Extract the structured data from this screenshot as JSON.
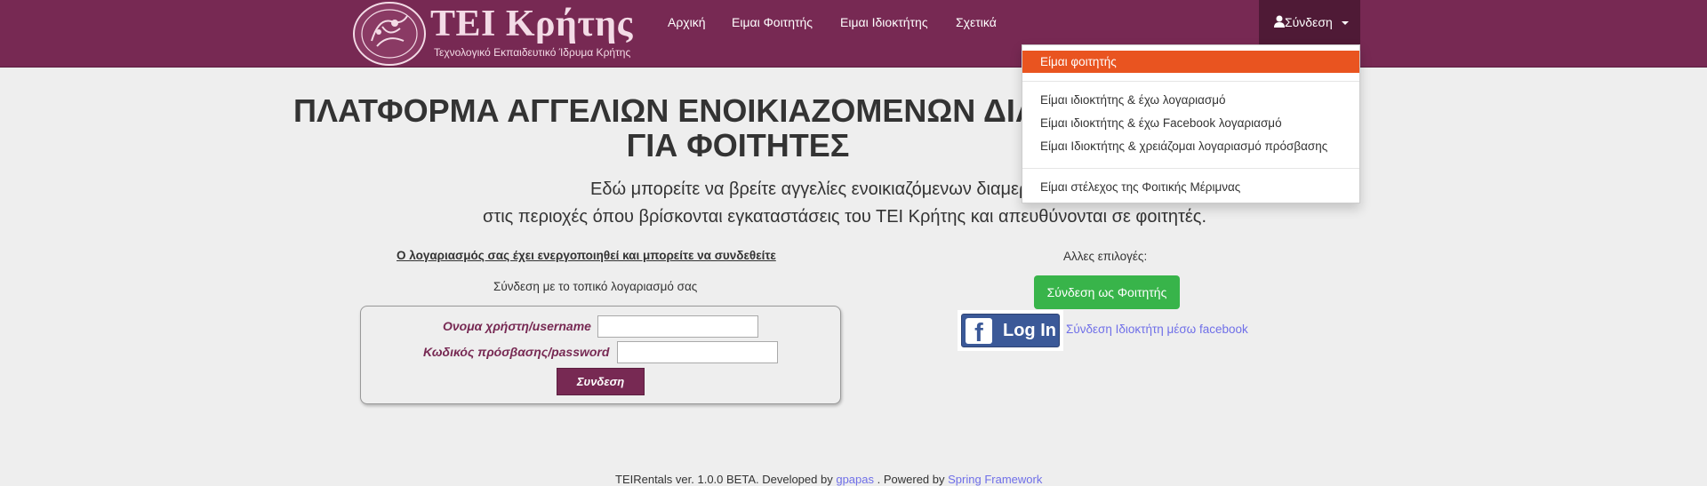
{
  "brand": {
    "title": "TEI Κρήτης",
    "subtitle": "Τεχνολογικό Εκπαιδευτικό Ίδρυμα Κρήτης"
  },
  "nav": {
    "items": [
      {
        "label": "Αρχική"
      },
      {
        "label": "Ειμαι Φοιτητής"
      },
      {
        "label": "Ειμαι Ιδιοκτήτης"
      },
      {
        "label": "Σχετικά"
      }
    ],
    "login_label": "Σύνδεση"
  },
  "dropdown": {
    "items": [
      {
        "label": "Είμαι φοιτητής"
      },
      {
        "label": "Είμαι ιδιοκτήτης & έχω λογαριασμό"
      },
      {
        "label": "Είμαι ιδιοκτήτης & έχω Facebook λογαριασμό"
      },
      {
        "label": "Είμαι Ιδιοκτήτης & χρειάζομαι λογαριασμό πρόσβασης"
      },
      {
        "label": "Είμαι στέλεχος της Φοιτικής Μέριμνας"
      }
    ]
  },
  "main": {
    "title_line1": "ΠΛΑΤΦΟΡΜΑ ΑΓΓΕΛΙΩΝ ΕΝΟΙΚΙΑΖΟΜΕΝΩΝ ΔΙΑΜΕΡΙΣΜΑΤΩΝ",
    "title_line2": "ΓΙΑ ΦΟΙΤΗΤΕΣ",
    "subtitle_line1": "Εδώ μπορείτε να βρείτε αγγελίες ενοικιαζόμενων διαμερισμάτων,",
    "subtitle_line2": "στις περιοχές όπου βρίσκονται εγκαταστάσεις του ΤΕΙ Κρήτης και απευθύνονται σε φοιτητές."
  },
  "login": {
    "activated_message": "Ο λογαριασμός σας έχει ενεργοποιηθεί και μπορείτε να συνδεθείτε",
    "local_account_label": "Σύνδεση με το τοπικό λογαριασμό σας",
    "username_label": "Ονομα χρήστη/username",
    "username_value": "",
    "password_label": "Κωδικός πρόσβασης/password",
    "password_value": "",
    "submit_label": "Συνδεση"
  },
  "other": {
    "label": "Αλλες επιλογές:",
    "student_button": "Σύνδεση ως Φοιτητής",
    "facebook_button": "Log In",
    "facebook_link": "Σύνδεση Ιδιοκτήτη μέσω facebook"
  },
  "footer": {
    "text": "TEIRentals ver. 1.0.0 BETA. Developed by",
    "author": "gpapas",
    "powered": ". Powered by",
    "framework": "Spring Framework"
  },
  "colors": {
    "navbar": "#772953",
    "dropdown_active": "#e95420",
    "student_button": "#38b44a",
    "facebook": "#3b5998"
  }
}
